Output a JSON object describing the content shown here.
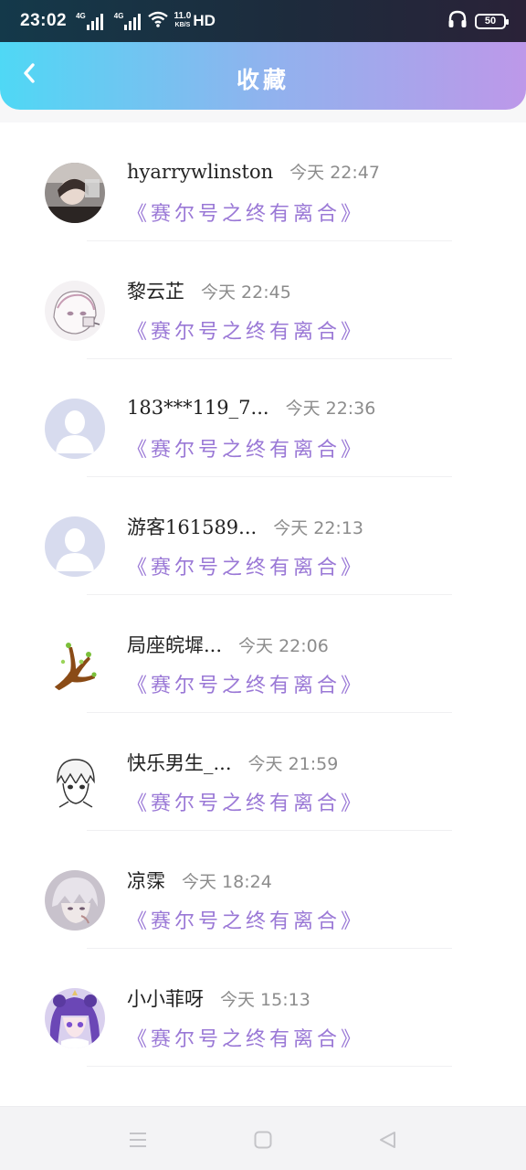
{
  "status_bar": {
    "time": "23:02",
    "network_tag_1": "4G",
    "network_tag_2": "4G",
    "speed_value": "11.0",
    "speed_unit": "KB/S",
    "hd_label": "HD",
    "battery": "50",
    "icons": [
      "signal-icon",
      "signal-icon",
      "wifi-icon",
      "headphones-icon",
      "battery-icon"
    ]
  },
  "header": {
    "title": "收藏",
    "back_icon": "chevron-left-icon"
  },
  "favorites": [
    {
      "name": "hyarrywlinston",
      "time": "今天 22:47",
      "book": "《赛尔号之终有离合》",
      "avatar": "photo-avatar"
    },
    {
      "name": "黎云芷",
      "time": "今天 22:45",
      "book": "《赛尔号之终有离合》",
      "avatar": "anime-sketch-avatar"
    },
    {
      "name": "183***119_7...",
      "time": "今天 22:36",
      "book": "《赛尔号之终有离合》",
      "avatar": "default-avatar"
    },
    {
      "name": "游客161589...",
      "time": "今天 22:13",
      "book": "《赛尔号之终有离合》",
      "avatar": "default-avatar"
    },
    {
      "name": "局座皖墀...",
      "time": "今天 22:06",
      "book": "《赛尔号之终有离合》",
      "avatar": "tree-avatar"
    },
    {
      "name": "快乐男生_...",
      "time": "今天 21:59",
      "book": "《赛尔号之终有离合》",
      "avatar": "manga-avatar"
    },
    {
      "name": "凉霂",
      "time": "今天 18:24",
      "book": "《赛尔号之终有离合》",
      "avatar": "anime-avatar"
    },
    {
      "name": "小小菲呀",
      "time": "今天 15:13",
      "book": "《赛尔号之终有离合》",
      "avatar": "anime-purple-avatar"
    }
  ],
  "nav_bar": {
    "icons": [
      "menu-icon",
      "home-square-icon",
      "back-triangle-icon"
    ]
  },
  "colors": {
    "header_start": "#4fd8f5",
    "header_end": "#bd98e9",
    "book_title": "#9a78d6",
    "time_text": "#8c8c8c"
  }
}
